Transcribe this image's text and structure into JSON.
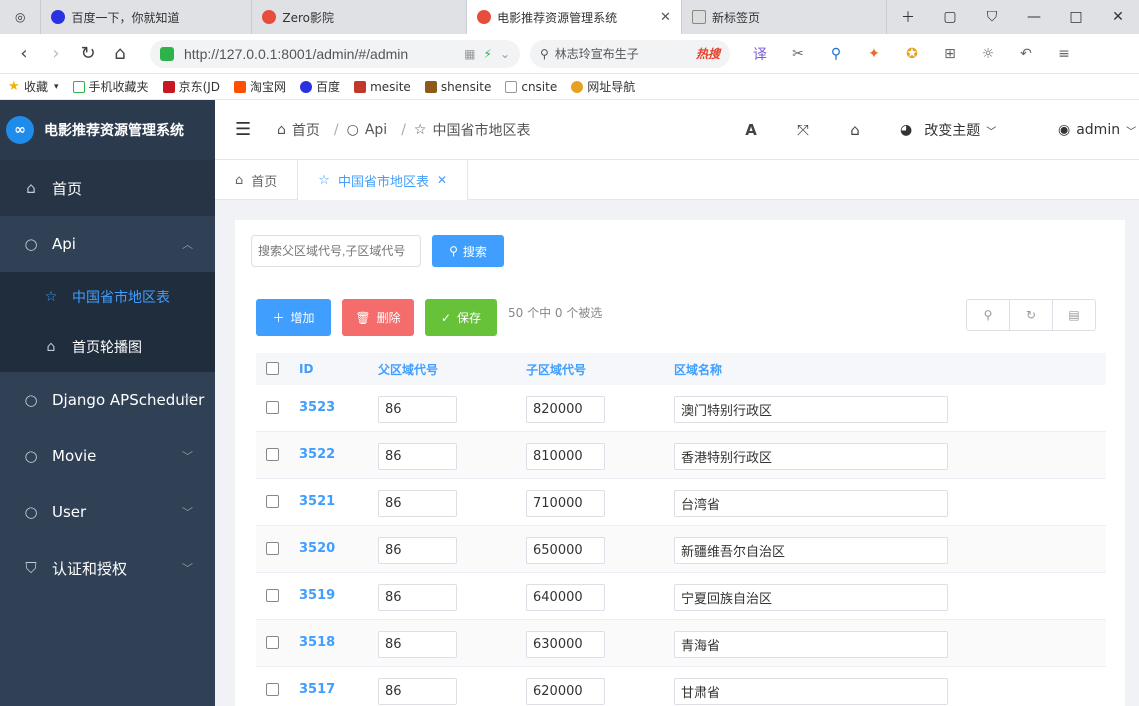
{
  "browser": {
    "tabs": [
      {
        "title": "百度一下，你就知道",
        "color": "#2932e1"
      },
      {
        "title": "Zero影院",
        "color": "#e84c3d"
      },
      {
        "title": "电影推荐资源管理系统",
        "color": "#e84c3d"
      },
      {
        "title": "新标签页",
        "color": "#666666"
      }
    ],
    "url": "http://127.0.0.1:8001/admin/#/admin",
    "search_text": "林志玲宣布生子",
    "search_hot": "热搜",
    "bookmarks": [
      "收藏",
      "手机收藏夹",
      "京东(JD",
      "淘宝网",
      "百度",
      "mesite",
      "shensite",
      "cnsite",
      "网址导航"
    ]
  },
  "app": {
    "title": "电影推荐资源管理系统",
    "sidebar": {
      "home": "首页",
      "api": "Api",
      "api_children": [
        "中国省市地区表",
        "首页轮播图"
      ],
      "others": [
        "Django APScheduler",
        "Movie",
        "User",
        "认证和授权"
      ]
    },
    "breadcrumb": [
      "首页",
      "Api",
      "中国省市地区表"
    ],
    "theme_label": "改变主题",
    "user_label": "admin",
    "tags": [
      "首页",
      "中国省市地区表"
    ],
    "search": {
      "placeholder": "搜索父区域代号,子区域代号",
      "button": "搜索"
    },
    "actions": {
      "add": "增加",
      "delete": "删除",
      "save": "保存",
      "selection_info": "50 个中 0 个被选"
    },
    "table": {
      "columns": [
        "ID",
        "父区域代号",
        "子区域代号",
        "区域名称"
      ],
      "rows": [
        {
          "id": "3523",
          "parent": "86",
          "child": "820000",
          "name": "澳门特别行政区"
        },
        {
          "id": "3522",
          "parent": "86",
          "child": "810000",
          "name": "香港特别行政区"
        },
        {
          "id": "3521",
          "parent": "86",
          "child": "710000",
          "name": "台湾省"
        },
        {
          "id": "3520",
          "parent": "86",
          "child": "650000",
          "name": "新疆维吾尔自治区"
        },
        {
          "id": "3519",
          "parent": "86",
          "child": "640000",
          "name": "宁夏回族自治区"
        },
        {
          "id": "3518",
          "parent": "86",
          "child": "630000",
          "name": "青海省"
        },
        {
          "id": "3517",
          "parent": "86",
          "child": "620000",
          "name": "甘肃省"
        }
      ]
    }
  },
  "colors": {
    "primary": "#409eff",
    "danger": "#f56c6c",
    "success": "#67c23a",
    "sidebar": "#304156"
  }
}
